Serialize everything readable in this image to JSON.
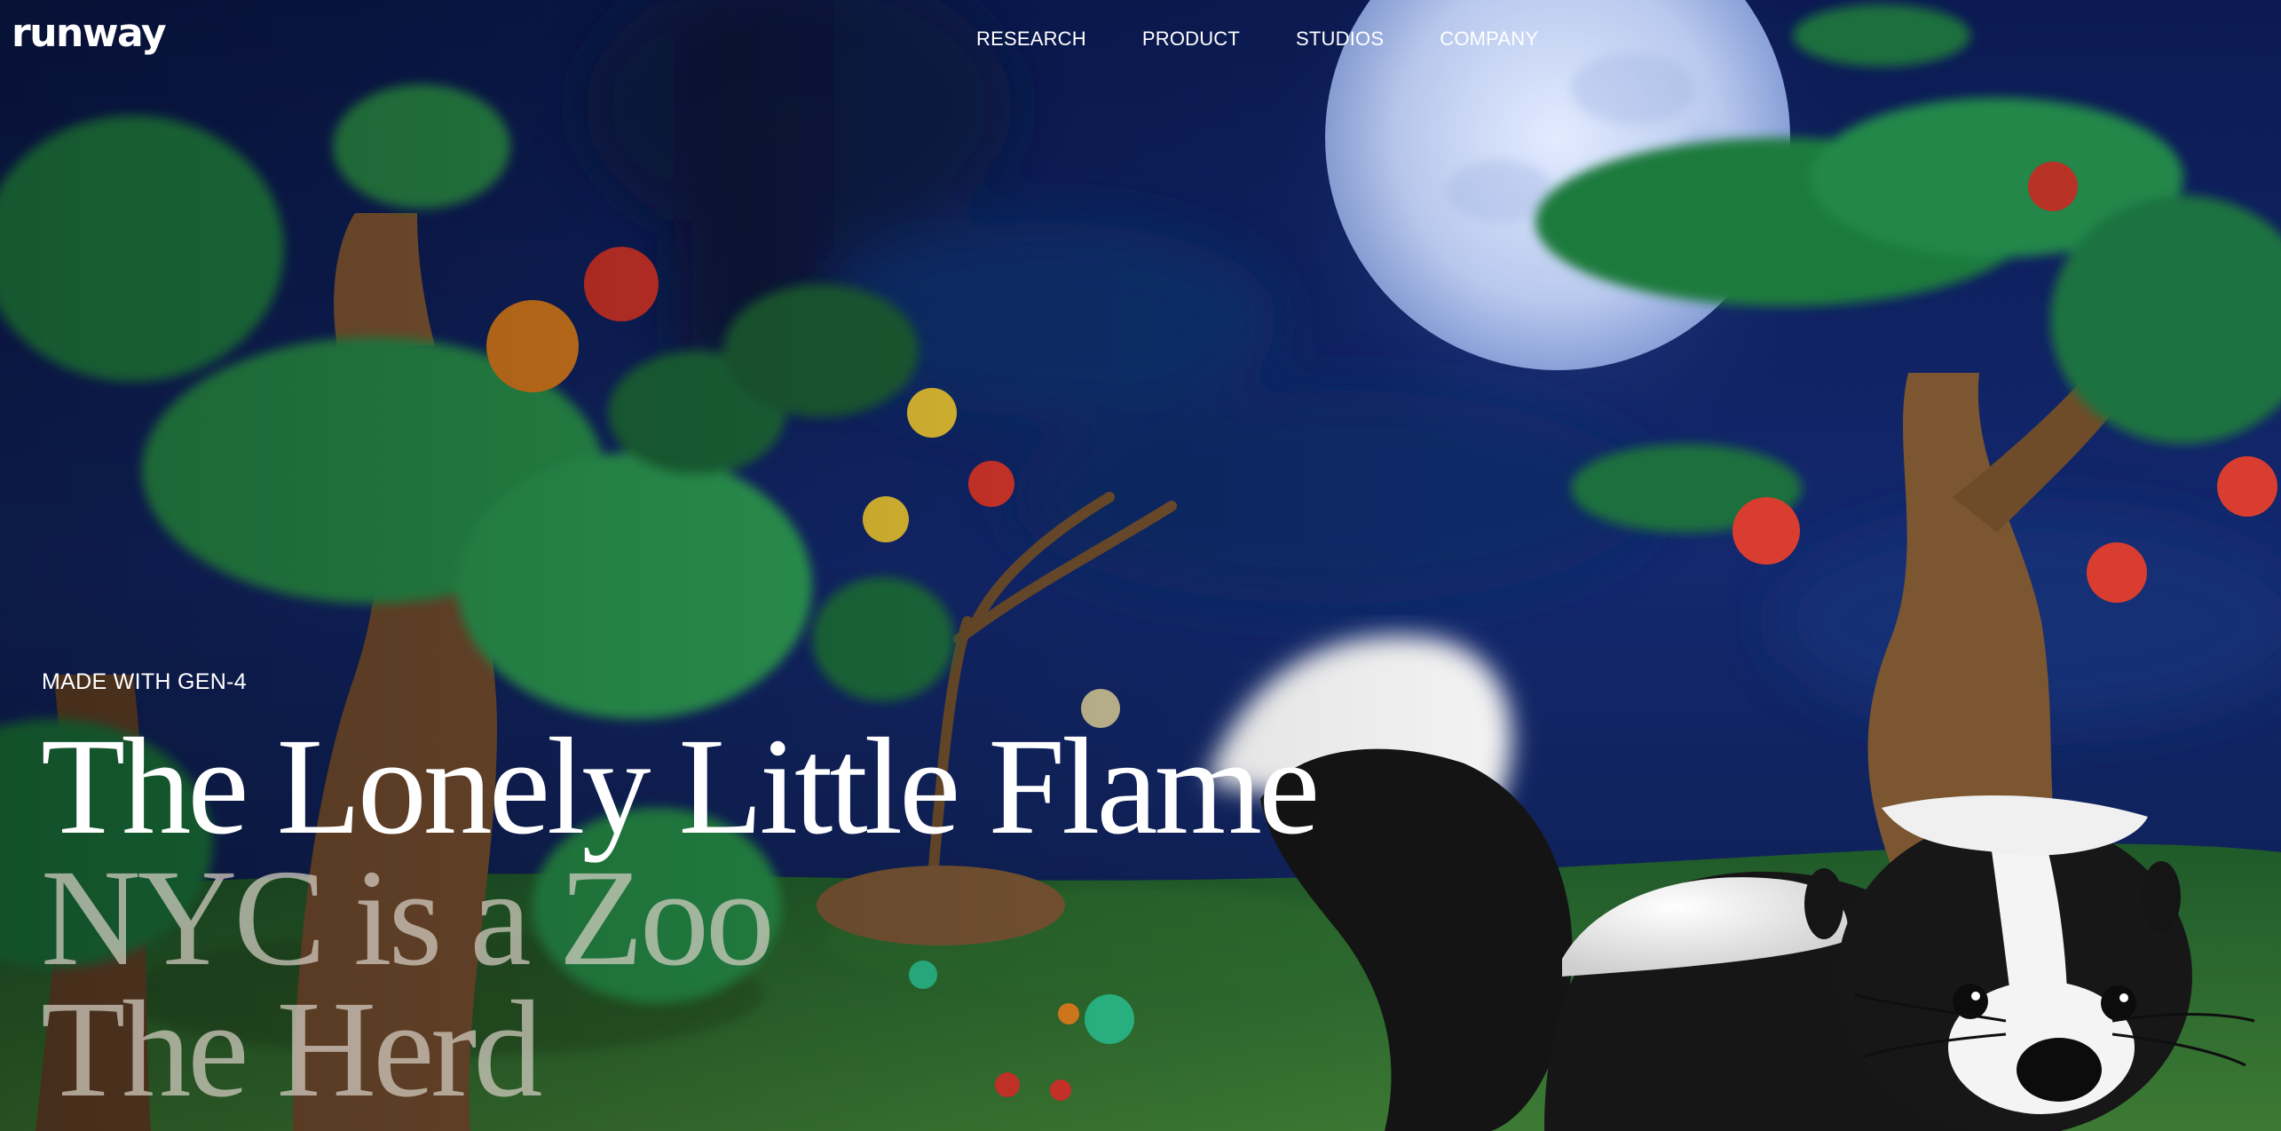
{
  "brand": {
    "logo_text": "runway"
  },
  "nav": {
    "items": [
      {
        "label": "RESEARCH"
      },
      {
        "label": "PRODUCT"
      },
      {
        "label": "STUDIOS"
      },
      {
        "label": "COMPANY"
      }
    ]
  },
  "hero": {
    "eyebrow": "MADE WITH GEN-4",
    "background_image": "claymation night forest with full moon, felt trees with colorful fruit, and a fluffy skunk",
    "titles": [
      {
        "label": "The Lonely Little Flame",
        "state": "active"
      },
      {
        "label": "NYC is a Zoo",
        "state": "inactive"
      },
      {
        "label": "The Herd",
        "state": "inactive"
      }
    ]
  },
  "colors": {
    "sky": "#0d1d5c",
    "moon": "#c9d6f2",
    "foliage": "#1f8a4a",
    "grass": "#2a6a2c",
    "text_active": "#ffffff",
    "text_inactive": "#b9b1a6"
  }
}
